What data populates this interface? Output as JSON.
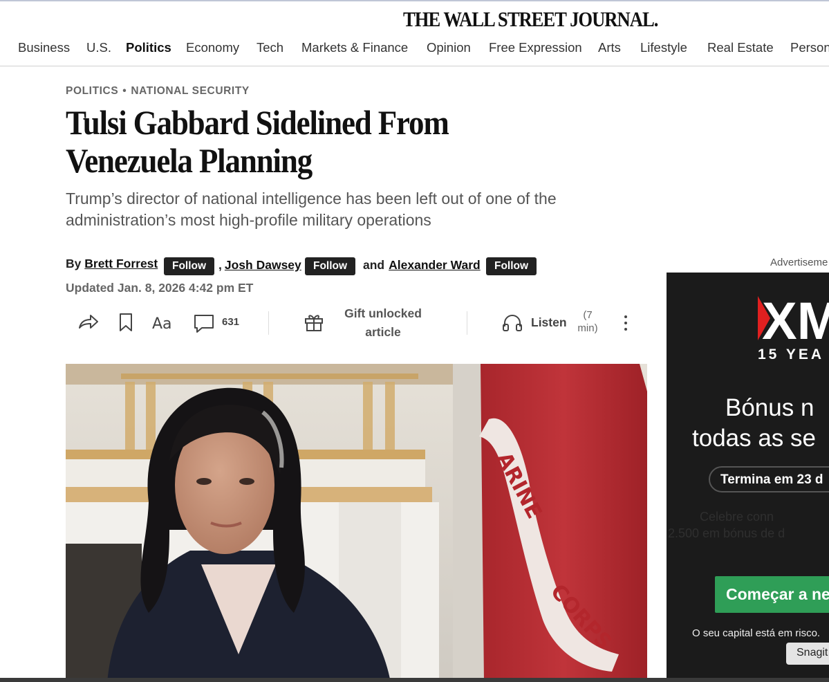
{
  "header": {
    "logo": "THE WALL STREET JOURNAL.",
    "nav": [
      "Business",
      "U.S.",
      "Politics",
      "Economy",
      "Tech",
      "Markets & Finance",
      "Opinion",
      "Free Expression",
      "Arts",
      "Lifestyle",
      "Real Estate",
      "Person"
    ],
    "active_nav": "Politics"
  },
  "article": {
    "kicker_section": "POLITICS",
    "kicker_dot": "•",
    "kicker_topic": "NATIONAL SECURITY",
    "headline": "Tulsi Gabbard Sidelined From Venezuela Planning",
    "dek": "Trump’s director of national intelligence has been left out of one of the administration’s most high-profile military operations",
    "byline": {
      "by": "By",
      "authors": [
        "Brett Forrest",
        "Josh Dawsey",
        "Alexander Ward"
      ],
      "comma": ",",
      "and": "and",
      "follow_label": "Follow"
    },
    "updated": "Updated Jan. 8, 2026 4:42 pm ET"
  },
  "toolbar": {
    "comment_count": "631",
    "gift_label": "Gift unlocked article",
    "listen_label": "Listen",
    "listen_duration": "(7 min)",
    "icons": [
      "share-icon",
      "bookmark-icon",
      "text-size-icon",
      "comment-icon",
      "gift-icon",
      "headphones-icon",
      "more-icon"
    ]
  },
  "ad": {
    "label": "Advertiseme",
    "logo": "XM",
    "years": "15 YEA",
    "headline_1": "Bónus n",
    "headline_2": "todas as se",
    "pill": "Termina em 23 d",
    "faint_1": "Celebre conn",
    "faint_2": "2.500 em bónus de d",
    "cta": "Começar a ne",
    "risk": "O seu capital está em risco.",
    "brand_color": "#e02020",
    "cta_color": "#2f9e57"
  },
  "overlay": {
    "snagit": "Snagit"
  }
}
